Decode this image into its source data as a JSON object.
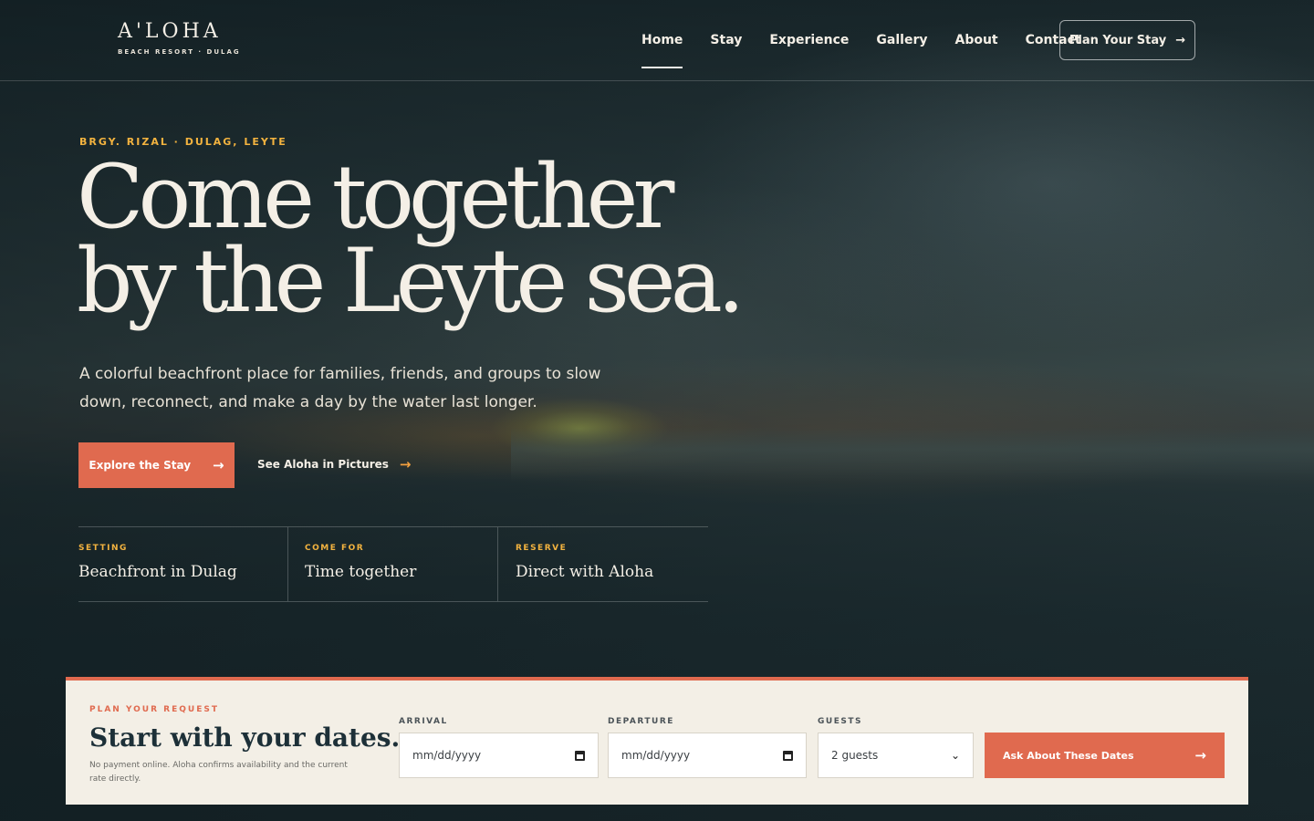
{
  "brand": {
    "name": "A'LOHA",
    "tagline": "BEACH RESORT · DULAG"
  },
  "nav": {
    "items": [
      {
        "label": "Home",
        "active": true
      },
      {
        "label": "Stay"
      },
      {
        "label": "Experience"
      },
      {
        "label": "Gallery"
      },
      {
        "label": "About"
      },
      {
        "label": "Contact"
      }
    ],
    "cta": "Plan Your Stay"
  },
  "hero": {
    "eyebrow": "BRGY. RIZAL · DULAG, LEYTE",
    "headline_line1": "Come together",
    "headline_line2": "by the Leyte sea.",
    "lead": "A colorful beachfront place for families, friends, and groups to slow down, reconnect, and make a day by the water last longer.",
    "primary_cta": "Explore the Stay",
    "secondary_cta": "See Aloha in Pictures",
    "facts": [
      {
        "label": "SETTING",
        "value": "Beachfront in Dulag"
      },
      {
        "label": "COME FOR",
        "value": "Time together"
      },
      {
        "label": "RESERVE",
        "value": "Direct with Aloha"
      }
    ]
  },
  "booking": {
    "eyebrow": "PLAN YOUR REQUEST",
    "title": "Start with your dates.",
    "note": "No payment online. Aloha confirms availability and the current rate directly.",
    "arrival_label": "ARRIVAL",
    "arrival_placeholder": "mm/dd/yyyy",
    "departure_label": "DEPARTURE",
    "departure_placeholder": "mm/dd/yyyy",
    "guests_label": "GUESTS",
    "guests_value": "2 guests",
    "submit": "Ask About These Dates"
  },
  "icons": {
    "arrow": "arrow-right-icon",
    "calendar": "calendar-icon",
    "chevron": "chevron-down-icon"
  },
  "colors": {
    "accent": "#e06a4f",
    "gold": "#f3b33f",
    "cream": "#f3efe6"
  }
}
